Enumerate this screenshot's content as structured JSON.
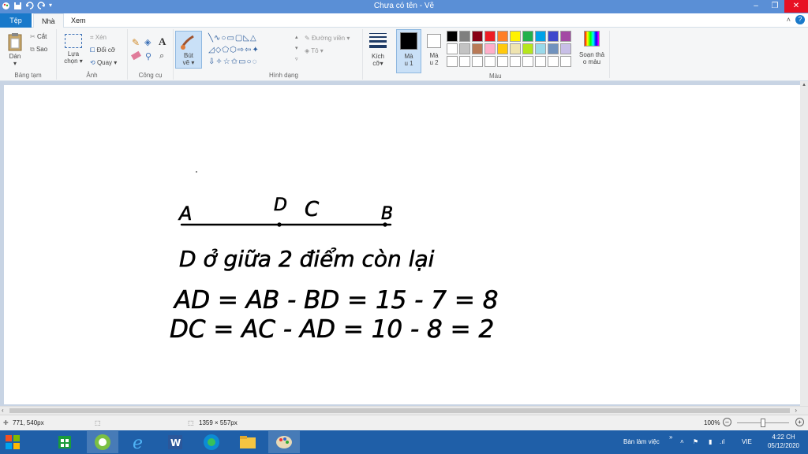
{
  "window": {
    "title": "Chưa có tên - Vẽ"
  },
  "tabs": {
    "file": "Tệp",
    "home": "Nhà",
    "view": "Xem"
  },
  "ribbon": {
    "clipboard": {
      "paste": "Dán",
      "cut": "Cắt",
      "copy": "Sao",
      "label": "Bảng tạm"
    },
    "image": {
      "select_1": "Lựa",
      "select_2": "chọn",
      "crop": "Xén",
      "resize": "Đổi cỡ",
      "rotate": "Quay",
      "label": "Ảnh"
    },
    "tools": {
      "label": "Công cụ"
    },
    "brush": {
      "line1": "Bút",
      "line2": "vẽ"
    },
    "shapes": {
      "outline": "Đường viền",
      "fill": "Tô",
      "label": "Hình dạng"
    },
    "size": {
      "line1": "Kích",
      "line2": "cỡ"
    },
    "color1": {
      "line1": "Mà",
      "line2": "u 1"
    },
    "color2": {
      "line1": "Mà",
      "line2": "u 2"
    },
    "edit_colors": {
      "line1": "Soạn thả",
      "line2": "o màu"
    },
    "colors_label": "Màu",
    "palette_row1": [
      "#000000",
      "#7f7f7f",
      "#880015",
      "#ed1c24",
      "#ff7f27",
      "#fff200",
      "#22b14c",
      "#00a2e8",
      "#3f48cc",
      "#a349a4"
    ],
    "palette_row2": [
      "#ffffff",
      "#c3c3c3",
      "#b97a57",
      "#ffaec9",
      "#ffc90e",
      "#efe4b0",
      "#b5e61d",
      "#99d9ea",
      "#7092be",
      "#c8bfe7"
    ]
  },
  "canvas_text": {
    "point_a": "A",
    "point_d": "D",
    "point_c": "C",
    "point_b": "B",
    "line1": "D ở giữa 2 điểm còn lại",
    "line2": "AD = AB - BD = 15 - 7 = 8",
    "line3": "DC = AC - AD = 10 - 8 = 2"
  },
  "status": {
    "cursor": "771, 540px",
    "size": "1359 × 557px",
    "zoom": "100%"
  },
  "tray": {
    "desktop": "Bàn làm việc",
    "lang": "VIE",
    "time": "4:22 CH",
    "date": "05/12/2020"
  }
}
